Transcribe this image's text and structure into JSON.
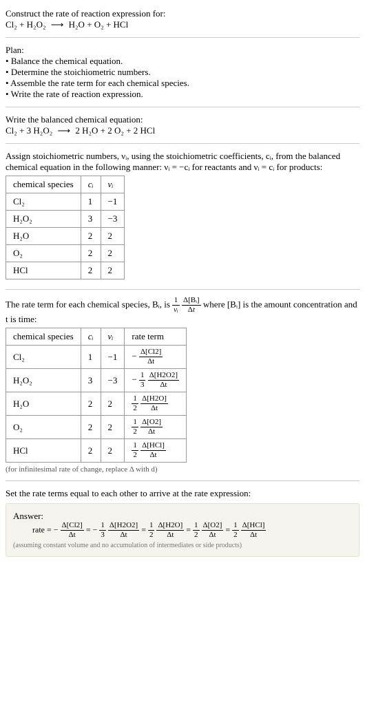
{
  "header": {
    "prompt": "Construct the rate of reaction expression for:",
    "unbalanced_lhs": "Cl₂ + H₂O₂",
    "arrow": "⟶",
    "unbalanced_rhs": "H₂O + O₂ + HCl"
  },
  "plan": {
    "title": "Plan:",
    "steps": [
      "Balance the chemical equation.",
      "Determine the stoichiometric numbers.",
      "Assemble the rate term for each chemical species.",
      "Write the rate of reaction expression."
    ]
  },
  "balanced": {
    "intro": "Write the balanced chemical equation:",
    "lhs": "Cl₂ + 3 H₂O₂",
    "arrow": "⟶",
    "rhs": "2 H₂O + 2 O₂ + 2 HCl"
  },
  "stoich_text": {
    "para": "Assign stoichiometric numbers, νᵢ, using the stoichiometric coefficients, cᵢ, from the balanced chemical equation in the following manner: νᵢ = −cᵢ for reactants and νᵢ = cᵢ for products:"
  },
  "table1": {
    "headers": [
      "chemical species",
      "cᵢ",
      "νᵢ"
    ],
    "rows": [
      {
        "species": "Cl₂",
        "c": "1",
        "v": "−1"
      },
      {
        "species": "H₂O₂",
        "c": "3",
        "v": "−3"
      },
      {
        "species": "H₂O",
        "c": "2",
        "v": "2"
      },
      {
        "species": "O₂",
        "c": "2",
        "v": "2"
      },
      {
        "species": "HCl",
        "c": "2",
        "v": "2"
      }
    ]
  },
  "rate_term_text": {
    "pre": "The rate term for each chemical species, Bᵢ, is ",
    "after": " where [Bᵢ] is the amount concentration and t is time:"
  },
  "table2": {
    "headers": [
      "chemical species",
      "cᵢ",
      "νᵢ",
      "rate term"
    ],
    "rows": [
      {
        "species": "Cl₂",
        "c": "1",
        "v": "−1",
        "sign": "−",
        "coef_num": "",
        "coef_den": "",
        "d_num": "Δ[Cl2]",
        "d_den": "Δt"
      },
      {
        "species": "H₂O₂",
        "c": "3",
        "v": "−3",
        "sign": "−",
        "coef_num": "1",
        "coef_den": "3",
        "d_num": "Δ[H2O2]",
        "d_den": "Δt"
      },
      {
        "species": "H₂O",
        "c": "2",
        "v": "2",
        "sign": "",
        "coef_num": "1",
        "coef_den": "2",
        "d_num": "Δ[H2O]",
        "d_den": "Δt"
      },
      {
        "species": "O₂",
        "c": "2",
        "v": "2",
        "sign": "",
        "coef_num": "1",
        "coef_den": "2",
        "d_num": "Δ[O2]",
        "d_den": "Δt"
      },
      {
        "species": "HCl",
        "c": "2",
        "v": "2",
        "sign": "",
        "coef_num": "1",
        "coef_den": "2",
        "d_num": "Δ[HCl]",
        "d_den": "Δt"
      }
    ]
  },
  "inf_note": "(for infinitesimal rate of change, replace Δ with d)",
  "final_intro": "Set the rate terms equal to each other to arrive at the rate expression:",
  "answer": {
    "label": "Answer:",
    "rate_word": "rate = ",
    "terms": [
      {
        "sign": "−",
        "coef_num": "",
        "coef_den": "",
        "d_num": "Δ[Cl2]",
        "d_den": "Δt"
      },
      {
        "sign": "−",
        "coef_num": "1",
        "coef_den": "3",
        "d_num": "Δ[H2O2]",
        "d_den": "Δt"
      },
      {
        "sign": "",
        "coef_num": "1",
        "coef_den": "2",
        "d_num": "Δ[H2O]",
        "d_den": "Δt"
      },
      {
        "sign": "",
        "coef_num": "1",
        "coef_den": "2",
        "d_num": "Δ[O2]",
        "d_den": "Δt"
      },
      {
        "sign": "",
        "coef_num": "1",
        "coef_den": "2",
        "d_num": "Δ[HCl]",
        "d_den": "Δt"
      }
    ],
    "note": "(assuming constant volume and no accumulation of intermediates or side products)"
  }
}
